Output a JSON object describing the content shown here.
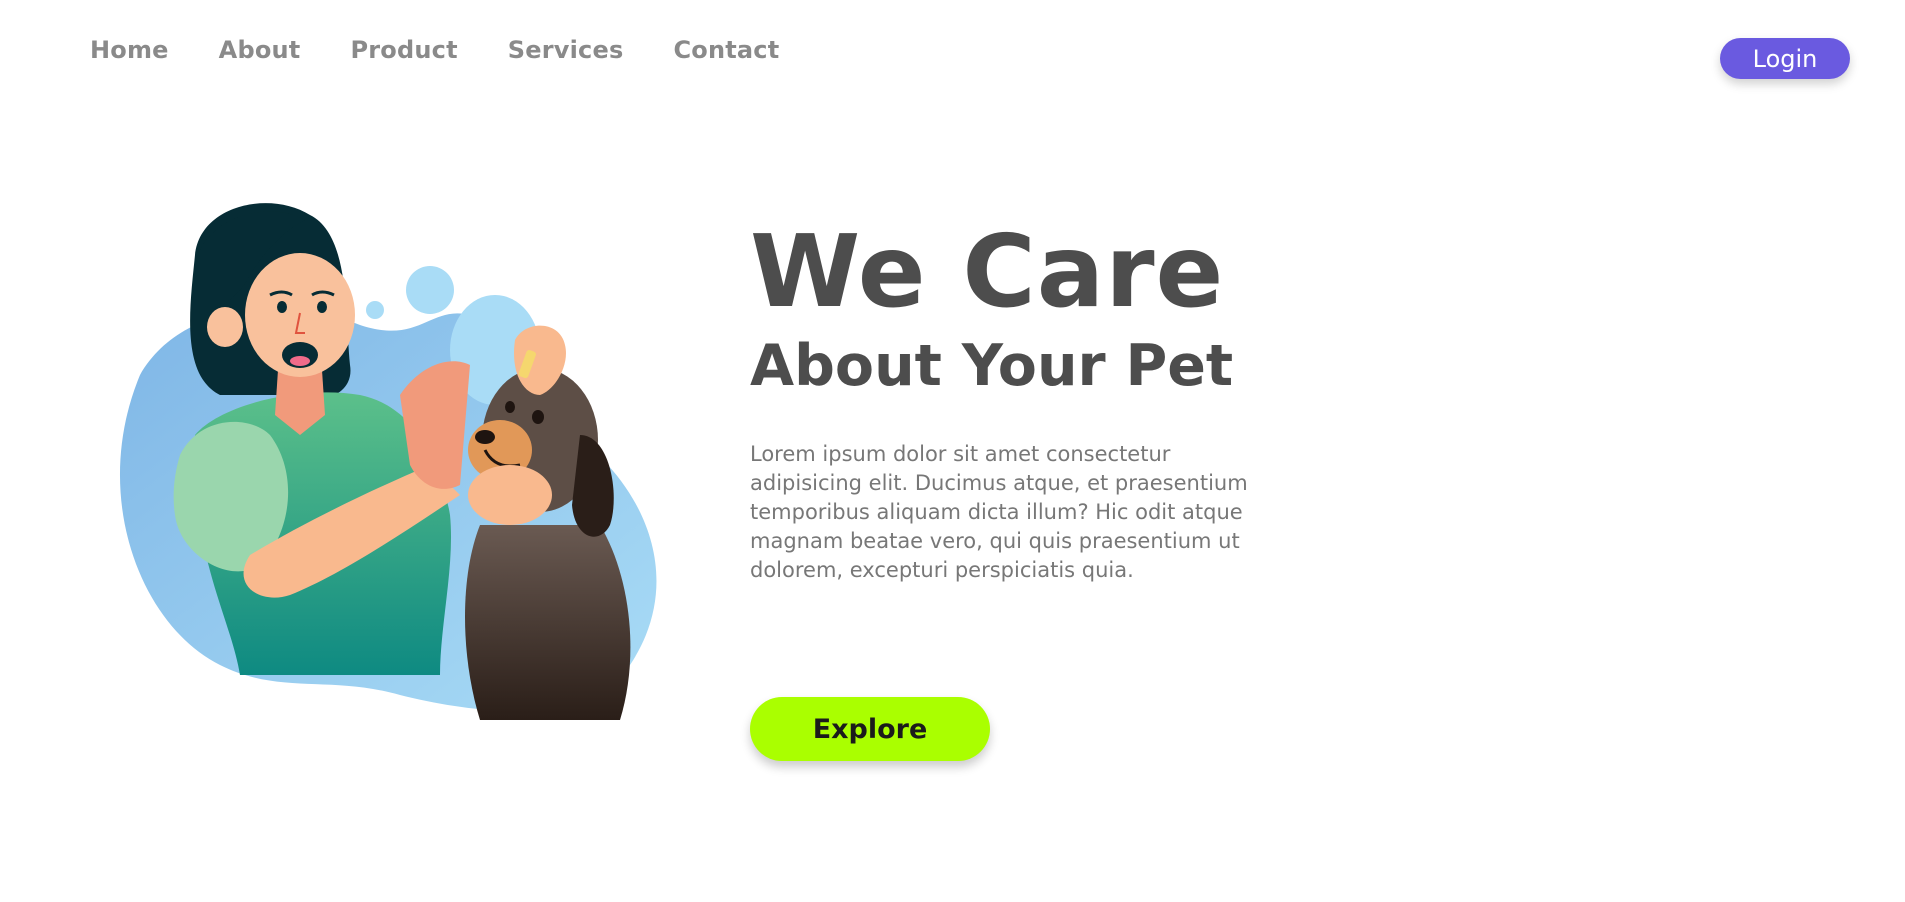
{
  "nav": {
    "items": [
      {
        "label": "Home"
      },
      {
        "label": "About"
      },
      {
        "label": "Product"
      },
      {
        "label": "Services"
      },
      {
        "label": "Contact"
      }
    ],
    "login_label": "Login"
  },
  "hero": {
    "title": "We Care",
    "subtitle": "About Your Pet",
    "body": "Lorem ipsum dolor sit amet consectetur adipisicing elit. Ducimus atque, et praesentium temporibus aliquam dicta illum? Hic odit atque magnam beatae vero, qui quis praesentium ut dolorem, excepturi perspiciatis quia.",
    "cta_label": "Explore"
  },
  "colors": {
    "login_bg": "#6a5ae0",
    "cta_bg": "#aaff00",
    "nav_text": "#8a8a8a",
    "heading_text": "#4d4d4d",
    "body_text": "#777777"
  },
  "icons": {
    "hero_illustration": "woman-with-dog-illustration"
  }
}
